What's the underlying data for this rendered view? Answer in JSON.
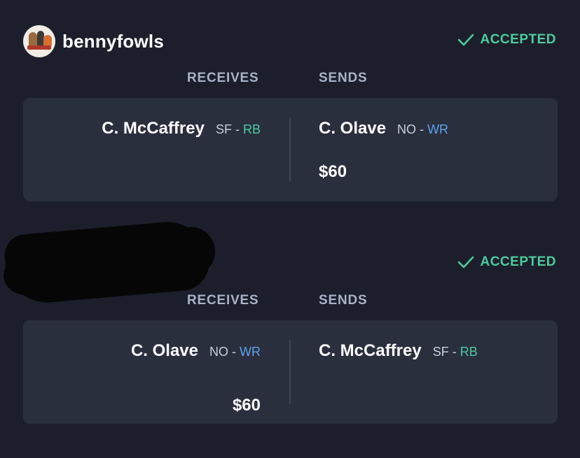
{
  "trades": [
    {
      "username": "bennyfowls",
      "status": "ACCEPTED",
      "receives_label": "RECEIVES",
      "sends_label": "SENDS",
      "receives": {
        "player": "C. McCaffrey",
        "team": "SF",
        "sep": "-",
        "position": "RB"
      },
      "sends": {
        "player": "C. Olave",
        "team": "NO",
        "sep": "-",
        "position": "WR",
        "money": "$60"
      }
    },
    {
      "username": "",
      "status": "ACCEPTED",
      "receives_label": "RECEIVES",
      "sends_label": "SENDS",
      "receives": {
        "player": "C. Olave",
        "team": "NO",
        "sep": "-",
        "position": "WR",
        "money": "$60"
      },
      "sends": {
        "player": "C. McCaffrey",
        "team": "SF",
        "sep": "-",
        "position": "RB"
      }
    }
  ],
  "colors": {
    "background": "#1c1f2b",
    "card": "#2a2f3e",
    "accepted": "#4ecb9e",
    "rb": "#4ecb9e",
    "wr": "#5ea3ea"
  },
  "icons": {
    "status": "check-icon",
    "avatar": "avatar-icon"
  }
}
